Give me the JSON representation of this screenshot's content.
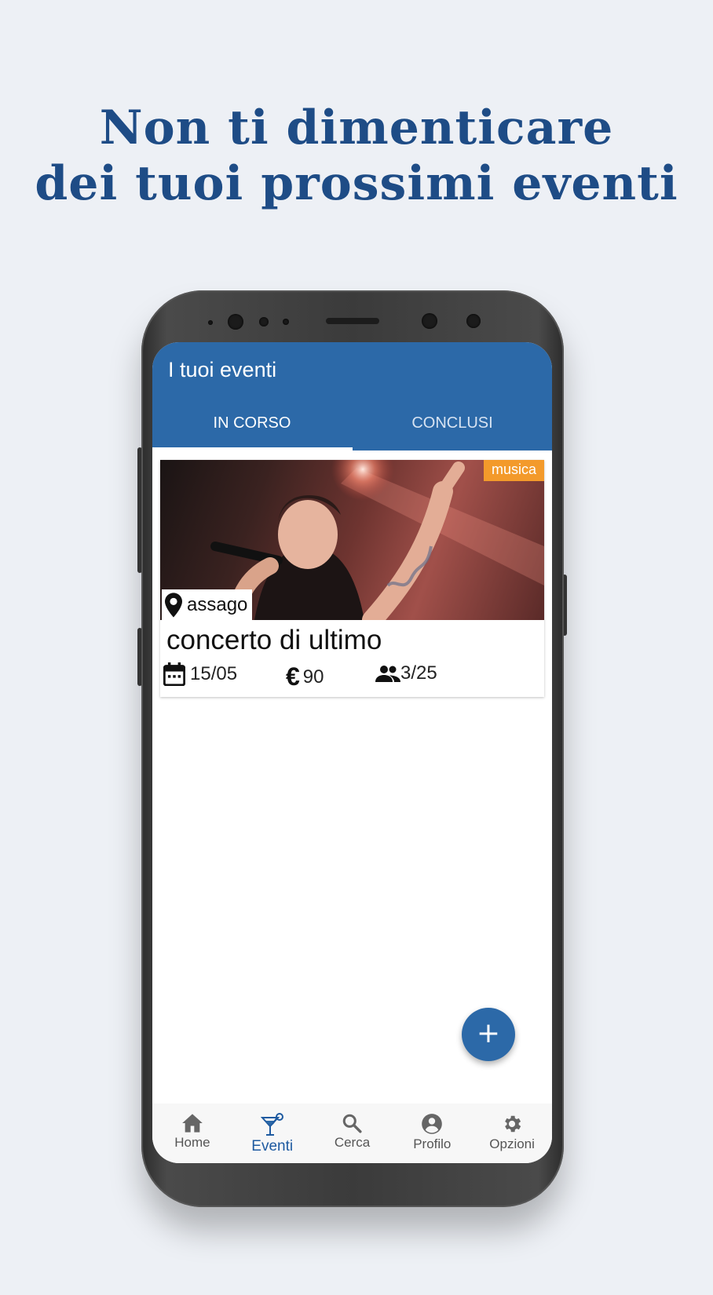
{
  "headline": {
    "line1": "Non ti dimenticare",
    "line2": "dei tuoi prossimi eventi"
  },
  "app": {
    "title": "I tuoi eventi",
    "tabs": [
      {
        "label": "IN CORSO",
        "active": true
      },
      {
        "label": "CONCLUSI",
        "active": false
      }
    ]
  },
  "event_card": {
    "category": "musica",
    "location": "assago",
    "title": "concerto di ultimo",
    "date": "15/05",
    "price": "90",
    "participants": "3/25"
  },
  "fab": {
    "label": "+"
  },
  "bottom_nav": [
    {
      "label": "Home",
      "icon": "home-icon"
    },
    {
      "label": "Eventi",
      "icon": "cocktail-icon",
      "active": true
    },
    {
      "label": "Cerca",
      "icon": "search-icon"
    },
    {
      "label": "Profilo",
      "icon": "account-circle-icon"
    },
    {
      "label": "Opzioni",
      "icon": "gear-icon"
    }
  ],
  "colors": {
    "primary": "#2c69a8",
    "headline": "#1e4c86",
    "badge": "#f39a2b",
    "background": "#edf0f5"
  }
}
